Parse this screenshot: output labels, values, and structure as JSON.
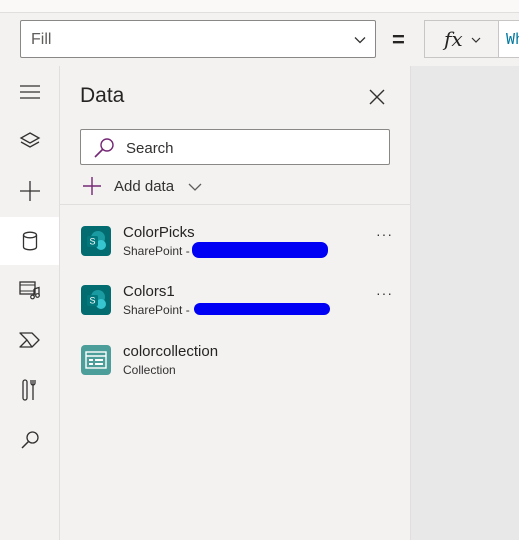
{
  "formula_bar": {
    "property": "Fill",
    "equals": "=",
    "fx_label": "fx",
    "formula_text": "Wh"
  },
  "rail": {
    "items": [
      {
        "name": "menu",
        "icon": "hamburger-icon"
      },
      {
        "name": "tree-view",
        "icon": "layers-icon"
      },
      {
        "name": "insert",
        "icon": "plus-icon"
      },
      {
        "name": "data",
        "icon": "database-icon",
        "active": true
      },
      {
        "name": "media",
        "icon": "media-icon"
      },
      {
        "name": "power-automate",
        "icon": "power-automate-icon"
      },
      {
        "name": "advanced-tools",
        "icon": "tools-icon"
      },
      {
        "name": "search",
        "icon": "search-icon"
      }
    ]
  },
  "data_pane": {
    "title": "Data",
    "search_placeholder": "Search",
    "add_data_label": "Add data",
    "sources": [
      {
        "name": "ColorPicks",
        "type": "SharePoint - ",
        "kind": "sharepoint",
        "more": "···"
      },
      {
        "name": "Colors1",
        "type": "SharePoint - ",
        "kind": "sharepoint",
        "more": "···"
      },
      {
        "name": "colorcollection",
        "type": "Collection",
        "kind": "collection"
      }
    ]
  },
  "colors": {
    "sharepoint_icon": "#036c70",
    "collection_icon": "#4c9e9a",
    "accent": "#742774",
    "redaction": "#0000f5"
  }
}
